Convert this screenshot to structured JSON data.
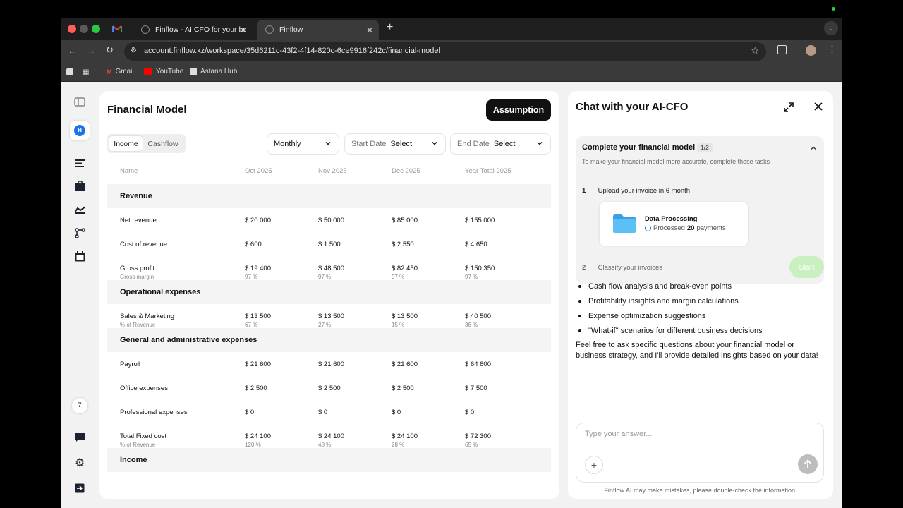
{
  "browser": {
    "tabs": [
      {
        "label": "Finflow - AI CFO for your bus"
      },
      {
        "label": "Finflow"
      }
    ],
    "url": "account.finflow.kz/workspace/35d6211c-43f2-4f14-820c-6ce9916f242c/financial-model",
    "bookmarks": [
      "Gmail",
      "YouTube",
      "Astana Hub"
    ]
  },
  "rail": {
    "avatar_initial": "H",
    "badge_count": "7"
  },
  "main": {
    "title": "Financial Model",
    "assumption_label": "Assumption",
    "tabs": [
      "Income",
      "Cashflow"
    ],
    "period": "Monthly",
    "start_date": {
      "label": "Start Date",
      "value": "Select"
    },
    "end_date": {
      "label": "End Date",
      "value": "Select"
    },
    "columns": [
      "Name",
      "Oct 2025",
      "Nov 2025",
      "Dec 2025",
      "Year Total 2025"
    ],
    "sections": [
      {
        "title": "Revenue",
        "rows": [
          {
            "name": "Net revenue",
            "sub": "",
            "values": [
              "$ 20 000",
              "$ 50 000",
              "$ 85 000",
              "$ 155 000"
            ],
            "subs": [
              "",
              "",
              "",
              ""
            ]
          },
          {
            "name": "Cost of revenue",
            "sub": "",
            "values": [
              "$ 600",
              "$ 1 500",
              "$ 2 550",
              "$ 4 650"
            ],
            "subs": [
              "",
              "",
              "",
              ""
            ]
          },
          {
            "name": "Gross profit",
            "sub": "Gross margin",
            "values": [
              "$ 19 400",
              "$ 48 500",
              "$ 82 450",
              "$ 150 350"
            ],
            "subs": [
              "97 %",
              "97 %",
              "97 %",
              "97 %"
            ]
          }
        ]
      },
      {
        "title": "Operational expenses",
        "rows": [
          {
            "name": "Sales & Marketing",
            "sub": "% of Revenue",
            "values": [
              "$ 13 500",
              "$ 13 500",
              "$ 13 500",
              "$ 40 500"
            ],
            "subs": [
              "67 %",
              "27 %",
              "15 %",
              "36 %"
            ]
          }
        ]
      },
      {
        "title": "General and administrative expenses",
        "rows": [
          {
            "name": "Payroll",
            "sub": "",
            "values": [
              "$ 21 600",
              "$ 21 600",
              "$ 21 600",
              "$ 64 800"
            ],
            "subs": [
              "",
              "",
              "",
              ""
            ]
          },
          {
            "name": "Office expenses",
            "sub": "",
            "values": [
              "$ 2 500",
              "$ 2 500",
              "$ 2 500",
              "$ 7 500"
            ],
            "subs": [
              "",
              "",
              "",
              ""
            ]
          },
          {
            "name": "Professional expenses",
            "sub": "",
            "values": [
              "$ 0",
              "$ 0",
              "$ 0",
              "$ 0"
            ],
            "subs": [
              "",
              "",
              "",
              ""
            ]
          },
          {
            "name": "Total Fixed cost",
            "sub": "% of Revenue",
            "values": [
              "$ 24 100",
              "$ 24 100",
              "$ 24 100",
              "$ 72 300"
            ],
            "subs": [
              "120 %",
              "48 %",
              "28 %",
              "65 %"
            ]
          }
        ]
      },
      {
        "title": "Income",
        "rows": []
      }
    ]
  },
  "chat": {
    "title": "Chat with your AI-CFO",
    "tasks": {
      "title": "Complete your financial model",
      "count": "1/2",
      "description": "To make your financial model more accurate, complete these tasks",
      "step1": {
        "num": "1",
        "label": "Upload your invoice in 6 month"
      },
      "processing": {
        "title": "Data Processing",
        "prefix": "Processed",
        "count": "20",
        "suffix": "payments"
      },
      "step2": {
        "num": "2",
        "label": "Classify your invoices"
      },
      "start_label": "Start"
    },
    "bullets": [
      "Cash flow analysis and break-even points",
      "Profitability insights and margin calculations",
      "Expense optimization suggestions",
      "\"What-if\" scenarios for different business decisions"
    ],
    "closing": "Feel free to ask specific questions about your financial model or business strategy, and I'll provide detailed insights based on your data!",
    "input_placeholder": "Type your answer...",
    "disclaimer": "Finflow AI may make mistakes, please double-check the information."
  },
  "colors": {
    "accent": "#1a73e8",
    "start_button": "#c9f0c0",
    "dark_button": "#111111"
  }
}
